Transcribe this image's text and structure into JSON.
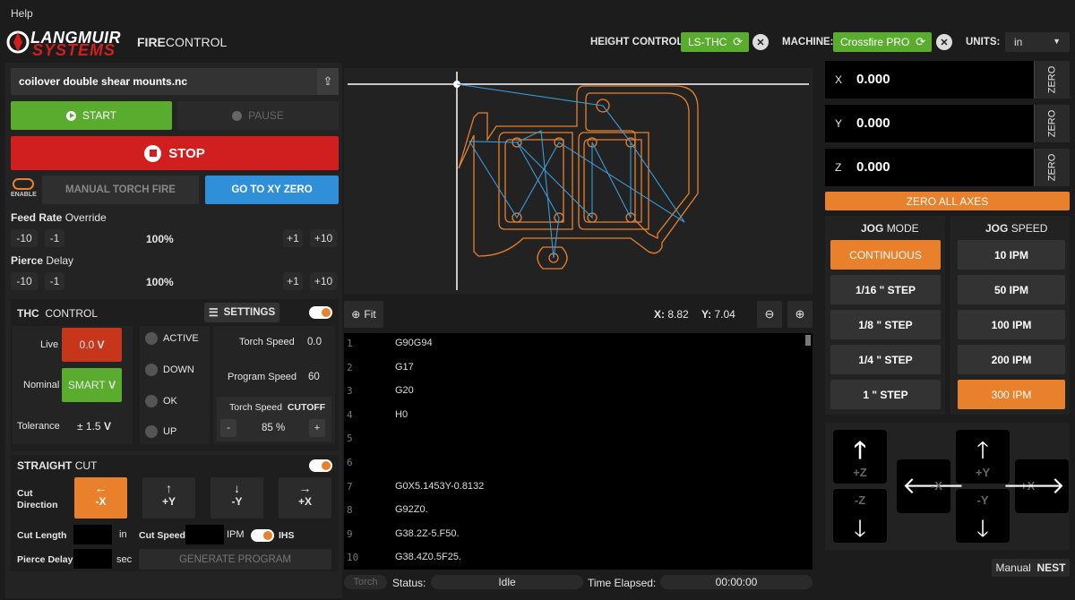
{
  "menu": {
    "help": "Help"
  },
  "brand": {
    "logo_line1": "LANGMUIR",
    "logo_line2": "SYSTEMS",
    "app_name_bold": "FIRE",
    "app_name_rest": "CONTROL"
  },
  "header": {
    "height_control_label": "HEIGHT CONTROL:",
    "height_control_value": "LS-THC",
    "machine_label": "MACHINE:",
    "machine_value": "Crossfire PRO",
    "units_label": "UNITS:",
    "units_value": "in"
  },
  "file": {
    "name": "coilover double shear mounts.nc"
  },
  "controls": {
    "start": "START",
    "pause": "PAUSE",
    "stop": "STOP",
    "enable": "ENABLE",
    "manual_torch_fire": "MANUAL TORCH FIRE",
    "go_to_xy_zero": "GO TO XY ZERO"
  },
  "feed_rate": {
    "title_bold": "Feed Rate",
    "title_rest": "Override",
    "minus10": "-10",
    "minus1": "-1",
    "value": "100%",
    "plus1": "+1",
    "plus10": "+10"
  },
  "pierce_delay": {
    "title_bold": "Pierce",
    "title_rest": "Delay",
    "minus10": "-10",
    "minus1": "-1",
    "value": "100%",
    "plus1": "+1",
    "plus10": "+10"
  },
  "thc": {
    "title_bold": "THC",
    "title_rest": "CONTROL",
    "settings": "SETTINGS",
    "live_label": "Live",
    "live_value": "0.0",
    "live_unit": "V",
    "nominal_label": "Nominal",
    "nominal_value": "SMART",
    "nominal_unit": "V",
    "tolerance_label": "Tolerance",
    "tolerance_value": "± 1.5",
    "tolerance_unit": "V",
    "status_active": "ACTIVE",
    "status_down": "DOWN",
    "status_ok": "OK",
    "status_up": "UP",
    "torch_speed_label": "Torch Speed",
    "torch_speed_value": "0.0",
    "program_speed_label": "Program Speed",
    "program_speed_value": "60",
    "cutoff_label": "Torch Speed",
    "cutoff_bold": "CUTOFF",
    "cutoff_minus": "-",
    "cutoff_value": "85 %",
    "cutoff_plus": "+"
  },
  "straight_cut": {
    "title_bold": "STRAIGHT",
    "title_rest": "CUT",
    "direction_label_1": "Cut",
    "direction_label_2": "Direction",
    "dir_neg_x": "-X",
    "dir_pos_y": "+Y",
    "dir_neg_y": "-Y",
    "dir_pos_x": "+X",
    "cut_length_label": "Cut Length",
    "cut_length_unit": "in",
    "cut_speed_label": "Cut Speed",
    "cut_speed_unit": "IPM",
    "ihs_label": "IHS",
    "pierce_delay_label": "Pierce Delay",
    "pierce_delay_unit": "sec",
    "generate": "GENERATE PROGRAM"
  },
  "preview": {
    "fit": "Fit",
    "x_label": "X:",
    "x_value": "8.82",
    "y_label": "Y:",
    "y_value": "7.04"
  },
  "gcode_lines": [
    {
      "n": "1",
      "code": "G90G94"
    },
    {
      "n": "2",
      "code": "G17"
    },
    {
      "n": "3",
      "code": "G20"
    },
    {
      "n": "4",
      "code": "H0"
    },
    {
      "n": "5",
      "code": ""
    },
    {
      "n": "6",
      "code": ""
    },
    {
      "n": "7",
      "code": "G0X5.1453Y-0.8132"
    },
    {
      "n": "8",
      "code": "G92Z0."
    },
    {
      "n": "9",
      "code": "G38.2Z-5.F50."
    },
    {
      "n": "10",
      "code": "G38.4Z0.5F25."
    }
  ],
  "statusbar": {
    "torch": "Torch",
    "status_label": "Status:",
    "status_value": "Idle",
    "time_label": "Time Elapsed:",
    "time_value": "00:00:00"
  },
  "dro": {
    "x_label": "X",
    "x_value": "0.000",
    "y_label": "Y",
    "y_value": "0.000",
    "z_label": "Z",
    "z_value": "0.000",
    "zero": "ZERO",
    "zero_all": "ZERO ALL AXES"
  },
  "jog_mode": {
    "title_bold": "JOG",
    "title_rest": "MODE",
    "options": [
      "CONTINUOUS",
      "1/16 \" STEP",
      "1/8 \" STEP",
      "1/4 \" STEP",
      "1 \" STEP"
    ],
    "selected": "CONTINUOUS"
  },
  "jog_speed": {
    "title_bold": "JOG",
    "title_rest": "SPEED",
    "options": [
      "10 IPM",
      "50 IPM",
      "100 IPM",
      "200 IPM",
      "300 IPM"
    ],
    "selected": "300 IPM"
  },
  "jog": {
    "pz": "+Z",
    "nz": "-Z",
    "nx": "-X",
    "py": "+Y",
    "ny": "-Y",
    "px": "+X"
  },
  "footer": {
    "manual": "Manual",
    "nest": "NEST"
  },
  "colors": {
    "accent": "#e8802c",
    "green": "#5aac2f",
    "red": "#d11f1f",
    "blue": "#2f8fd8",
    "live_red": "#c7361a"
  }
}
